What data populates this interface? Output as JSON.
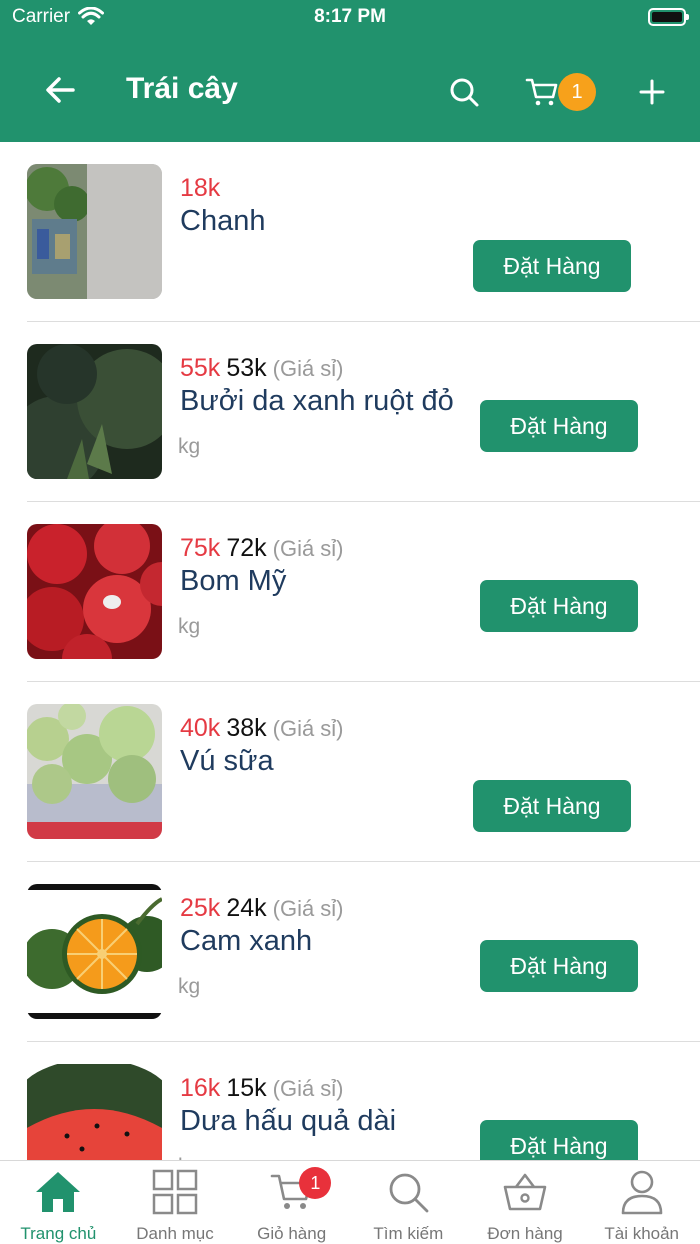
{
  "status_bar": {
    "carrier": "Carrier",
    "time": "8:17 PM"
  },
  "header": {
    "title": "Trái cây",
    "cart_count": "1"
  },
  "products": [
    {
      "retail_price": "18k",
      "wholesale_price": "",
      "wholesale_note": "",
      "name": "Chanh",
      "unit": "",
      "order_label": "Đặt Hàng"
    },
    {
      "retail_price": "55k",
      "wholesale_price": "53k",
      "wholesale_note": "(Giá sỉ)",
      "name": "Bưởi da xanh ruột đỏ",
      "unit": "kg",
      "order_label": "Đặt Hàng"
    },
    {
      "retail_price": "75k",
      "wholesale_price": "72k",
      "wholesale_note": "(Giá sỉ)",
      "name": "Bom Mỹ",
      "unit": "kg",
      "order_label": "Đặt Hàng"
    },
    {
      "retail_price": "40k",
      "wholesale_price": "38k",
      "wholesale_note": "(Giá sỉ)",
      "name": "Vú sữa",
      "unit": "",
      "order_label": "Đặt Hàng"
    },
    {
      "retail_price": "25k",
      "wholesale_price": "24k",
      "wholesale_note": "(Giá sỉ)",
      "name": "Cam xanh",
      "unit": "kg",
      "order_label": "Đặt Hàng"
    },
    {
      "retail_price": "16k",
      "wholesale_price": "15k",
      "wholesale_note": "(Giá sỉ)",
      "name": "Dưa hấu quả dài",
      "unit": "kg",
      "order_label": "Đặt Hàng"
    }
  ],
  "tabs": [
    {
      "label": "Trang chủ",
      "icon": "home-icon"
    },
    {
      "label": "Danh mục",
      "icon": "grid-icon"
    },
    {
      "label": "Giỏ hàng",
      "icon": "cart-icon",
      "badge": "1"
    },
    {
      "label": "Tìm kiếm",
      "icon": "search-icon"
    },
    {
      "label": "Đơn hàng",
      "icon": "basket-icon"
    },
    {
      "label": "Tài khoản",
      "icon": "user-icon"
    }
  ],
  "colors": {
    "primary": "#21926d",
    "price_red": "#e53a43",
    "badge_orange": "#f7a11b",
    "badge_red": "#e8313b"
  }
}
